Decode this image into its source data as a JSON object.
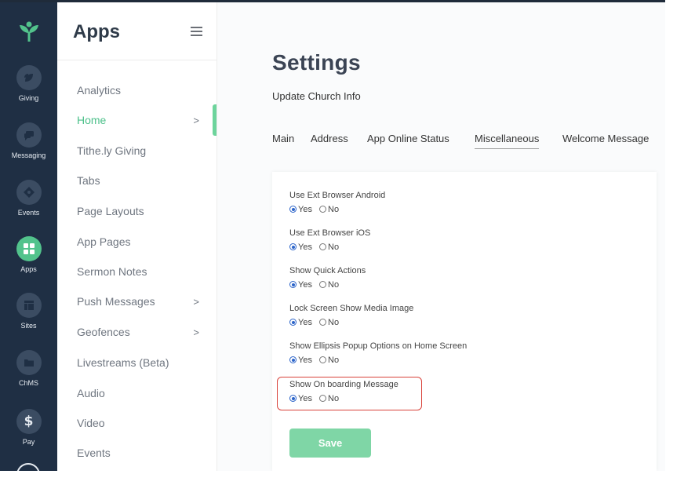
{
  "rail": {
    "items": [
      {
        "label": "Giving",
        "icon": "leaf-icon"
      },
      {
        "label": "Messaging",
        "icon": "chat-icon"
      },
      {
        "label": "Events",
        "icon": "ticket-icon"
      },
      {
        "label": "Apps",
        "icon": "grid-icon",
        "active": true
      },
      {
        "label": "Sites",
        "icon": "layout-icon"
      },
      {
        "label": "ChMS",
        "icon": "folder-icon"
      },
      {
        "label": "Pay",
        "icon": "dollar-icon"
      }
    ],
    "accent": "#52c38c",
    "background": "#1f2f44"
  },
  "subnav": {
    "title": "Apps",
    "items": [
      {
        "label": "Analytics"
      },
      {
        "label": "Home",
        "active": true,
        "chevron": ">"
      },
      {
        "label": "Tithe.ly Giving"
      },
      {
        "label": "Tabs"
      },
      {
        "label": "Page Layouts"
      },
      {
        "label": "App Pages"
      },
      {
        "label": "Sermon Notes"
      },
      {
        "label": "Push Messages",
        "chevron": ">"
      },
      {
        "label": "Geofences",
        "chevron": ">"
      },
      {
        "label": "Livestreams (Beta)"
      },
      {
        "label": "Audio"
      },
      {
        "label": "Video"
      },
      {
        "label": "Events"
      }
    ]
  },
  "main": {
    "title": "Settings",
    "subtitle": "Update Church Info",
    "tabs": [
      {
        "label": "Main"
      },
      {
        "label": "Address"
      },
      {
        "label": "App Online Status"
      },
      {
        "label": "Miscellaneous",
        "active": true
      },
      {
        "label": "Welcome Message"
      }
    ],
    "settings": [
      {
        "label": "Use Ext Browser Android",
        "yes": "Yes",
        "no": "No",
        "value": "yes"
      },
      {
        "label": "Use Ext Browser iOS",
        "yes": "Yes",
        "no": "No",
        "value": "yes"
      },
      {
        "label": "Show Quick Actions",
        "yes": "Yes",
        "no": "No",
        "value": "yes"
      },
      {
        "label": "Lock Screen Show Media Image",
        "yes": "Yes",
        "no": "No",
        "value": "yes"
      },
      {
        "label": "Show Ellipsis Popup Options on Home Screen",
        "yes": "Yes",
        "no": "No",
        "value": "yes"
      },
      {
        "label": "Show On boarding Message",
        "yes": "Yes",
        "no": "No",
        "value": "yes",
        "highlighted": true
      }
    ],
    "save_label": "Save",
    "colors": {
      "save_button": "#7fd6a6",
      "highlight": "#d9423a",
      "radio_checked": "#2c64c9"
    }
  }
}
